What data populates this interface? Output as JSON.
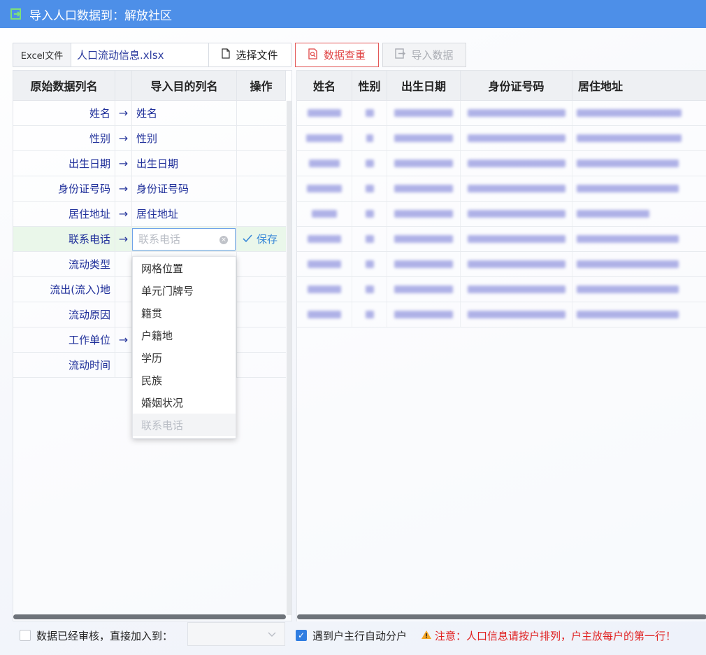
{
  "window": {
    "title": "导入人口数据到：解放社区"
  },
  "toolbar": {
    "excel_label": "Excel文件",
    "file_name": "人口流动信息.xlsx",
    "choose_label": "选择文件",
    "dedupe_label": "数据查重",
    "import_label": "导入数据"
  },
  "mapping": {
    "headers": {
      "source": "原始数据列名",
      "target": "导入目的列名",
      "action": "操作"
    },
    "rows": [
      {
        "source": "姓名",
        "arrow": "→",
        "target": "姓名"
      },
      {
        "source": "性别",
        "arrow": "→",
        "target": "性别"
      },
      {
        "source": "出生日期",
        "arrow": "→",
        "target": "出生日期"
      },
      {
        "source": "身份证号码",
        "arrow": "→",
        "target": "身份证号码"
      },
      {
        "source": "居住地址",
        "arrow": "→",
        "target": "居住地址"
      },
      {
        "source": "联系电话",
        "arrow": "→",
        "placeholder": "联系电话",
        "save": "保存"
      },
      {
        "source": "流动类型"
      },
      {
        "source": "流出(流入)地"
      },
      {
        "source": "流动原因"
      },
      {
        "source": "工作单位",
        "arrow": "→"
      },
      {
        "source": "流动时间"
      }
    ]
  },
  "dropdown": {
    "options": [
      "网格位置",
      "单元门牌号",
      "籍贯",
      "户籍地",
      "学历",
      "民族",
      "婚姻状况"
    ],
    "disabled_option": "联系电话"
  },
  "preview": {
    "headers": [
      "姓名",
      "性别",
      "出生日期",
      "身份证号码",
      "居住地址"
    ],
    "row_count": 9,
    "colors": {
      "blur_fill": "#7c80d8"
    }
  },
  "footer": {
    "audit_label": "数据已经审核，直接加入到：",
    "auto_split_label": "遇到户主行自动分户",
    "warning_text": "注意：人口信息请按户排列，户主放每户的第一行！"
  },
  "colors": {
    "titlebar": "#4d8fe8",
    "accent_red": "#e04646",
    "link_blue": "#3c8ad8"
  }
}
